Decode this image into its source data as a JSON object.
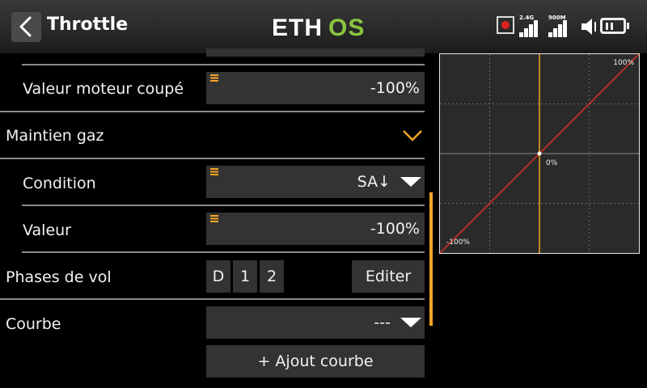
{
  "header": {
    "title": "Throttle",
    "logo_text": "ETHOS",
    "signal_24g_label": "2.4G",
    "signal_900m_label": "900M"
  },
  "form": {
    "cut_value": {
      "label": "Valeur moteur coupé",
      "value": "-100%"
    },
    "hold_section": {
      "label": "Maintien gaz",
      "expanded": true
    },
    "condition": {
      "label": "Condition",
      "value": "SA↓"
    },
    "hold_value": {
      "label": "Valeur",
      "value": "-100%"
    },
    "flight_modes": {
      "label": "Phases de vol",
      "items": [
        "D",
        "1",
        "2"
      ],
      "edit_label": "Editer"
    },
    "curve": {
      "label": "Courbe",
      "value": "---",
      "add_label": "+ Ajout courbe"
    }
  },
  "graph": {
    "top_label": "100%",
    "center_label": "0%",
    "bottom_label": "-100%"
  },
  "colors": {
    "accent": "#f5a623",
    "curve_line": "#e03020",
    "record_dot": "#e02020",
    "logo_green": "#8bc53f"
  }
}
